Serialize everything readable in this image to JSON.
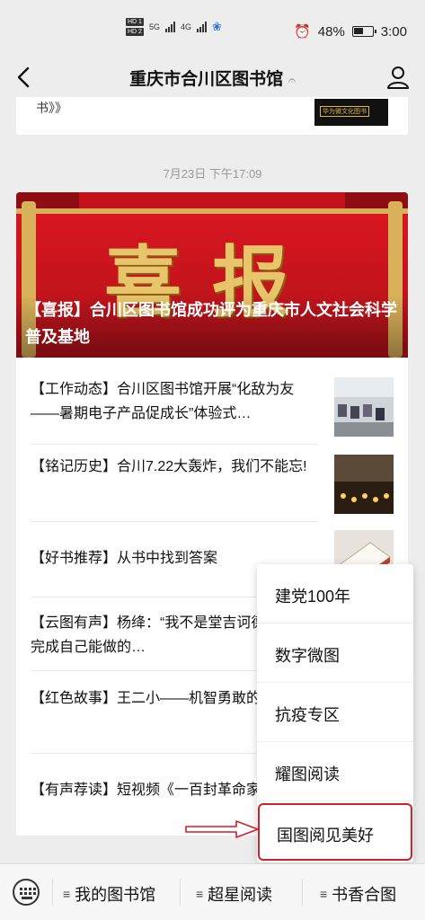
{
  "status_bar": {
    "hd1": "HD 1",
    "hd2": "HD 2",
    "net1": "5G",
    "net2": "4G",
    "battery": "48%",
    "time": "3:00"
  },
  "nav": {
    "title": "重庆市合川区图书馆",
    "back_icon": "chevron-left-icon",
    "profile_icon": "person-icon"
  },
  "prev_card": {
    "text_fragment": "书》》",
    "thumb_caption": "华为微文化图书"
  },
  "timestamp": "7月23日 下午17:09",
  "hero": {
    "big_text": "喜报",
    "title": "【喜报】合川区图书馆成功评为重庆市人文社会科学普及基地"
  },
  "articles": [
    {
      "text": "【工作动态】合川区图书馆开展“化敌为友——暑期电子产品促成长”体验式…",
      "thumb": "classroom-photo"
    },
    {
      "text": "【铭记历史】合川7.22大轰炸，我们不能忘!",
      "thumb": "candles-photo"
    },
    {
      "text": "【好书推荐】从书中找到答案",
      "thumb": "book-photo"
    },
    {
      "text": "【云图有声】杨绛：“我不是堂吉诃德…甘愿深处卑微，完成自己能做的…",
      "thumb": ""
    },
    {
      "text": "【红色故事】王二小——机智勇敢的娃",
      "thumb": ""
    },
    {
      "text": "【有声荐读】短视频《一百封革命家书》",
      "thumb": ""
    }
  ],
  "popup_menu": {
    "items": [
      "建党100年",
      "数字微图",
      "抗疫专区",
      "耀图阅读",
      "国图阅见美好"
    ],
    "highlight_color": "#d21f2a"
  },
  "bottom_menu": {
    "keyboard_icon": "keyboard-icon",
    "items": [
      "我的图书馆",
      "超星阅读",
      "书香合图"
    ]
  }
}
